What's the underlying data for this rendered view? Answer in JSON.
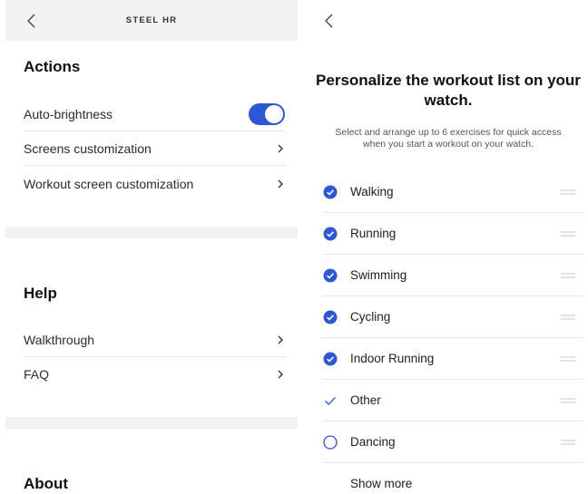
{
  "settings": {
    "header_title": "STEEL HR",
    "actions_heading": "Actions",
    "actions": [
      {
        "label": "Auto-brightness",
        "control": "toggle",
        "on": true
      },
      {
        "label": "Screens customization",
        "control": "chevron"
      },
      {
        "label": "Workout screen customization",
        "control": "chevron"
      }
    ],
    "help_heading": "Help",
    "help": [
      {
        "label": "Walkthrough",
        "control": "chevron"
      },
      {
        "label": "FAQ",
        "control": "chevron"
      }
    ],
    "about_heading": "About"
  },
  "workout": {
    "title": "Personalize the workout list on your watch.",
    "subtitle": "Select and arrange up to 6 exercises for quick access when you start a workout on your watch.",
    "items": [
      {
        "label": "Walking",
        "state": "checked"
      },
      {
        "label": "Running",
        "state": "checked"
      },
      {
        "label": "Swimming",
        "state": "checked"
      },
      {
        "label": "Cycling",
        "state": "checked"
      },
      {
        "label": "Indoor Running",
        "state": "checked"
      },
      {
        "label": "Other",
        "state": "tick"
      },
      {
        "label": "Dancing",
        "state": "unchecked"
      }
    ],
    "show_more_label": "Show more"
  },
  "colors": {
    "accent": "#2d57d3",
    "band": "#f2f2f2",
    "divider": "#e7e7e7"
  }
}
